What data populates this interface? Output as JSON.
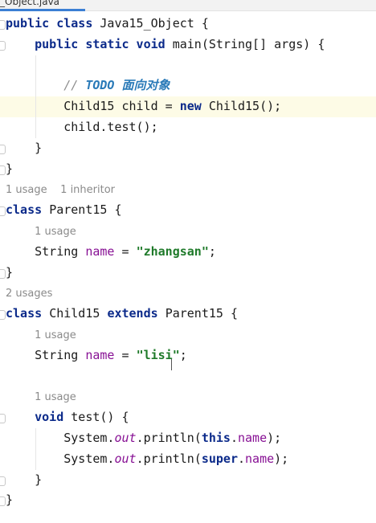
{
  "tab": {
    "label": "_Object.java"
  },
  "lines": [
    {
      "hl": false,
      "tokens": [
        [
          "kw",
          "public class "
        ],
        [
          "",
          "Java15_Object {"
        ]
      ]
    },
    {
      "hl": false,
      "tokens": [
        [
          "",
          "    "
        ],
        [
          "kw",
          "public static void "
        ],
        [
          "",
          "main(String[] args) {"
        ]
      ]
    },
    {
      "hl": false,
      "tokens": []
    },
    {
      "hl": false,
      "tokens": [
        [
          "",
          "        "
        ],
        [
          "cmt",
          "// "
        ],
        [
          "todo",
          "TODO 面向对象"
        ]
      ]
    },
    {
      "hl": true,
      "tokens": [
        [
          "",
          "        Child15 child = "
        ],
        [
          "kw",
          "new "
        ],
        [
          "",
          "Child15();"
        ]
      ]
    },
    {
      "hl": false,
      "tokens": [
        [
          "",
          "        child.test();"
        ]
      ]
    },
    {
      "hl": false,
      "tokens": [
        [
          "",
          "    }"
        ]
      ]
    },
    {
      "hl": false,
      "tokens": [
        [
          "",
          "}"
        ]
      ]
    },
    {
      "hl": false,
      "tokens": [
        [
          "hint",
          "1 usage    1 inheritor"
        ]
      ]
    },
    {
      "hl": false,
      "tokens": [
        [
          "kw",
          "class "
        ],
        [
          "",
          "Parent15 {"
        ]
      ]
    },
    {
      "hl": false,
      "tokens": [
        [
          "",
          "    "
        ],
        [
          "hint",
          "1 usage"
        ]
      ]
    },
    {
      "hl": false,
      "tokens": [
        [
          "",
          "    String "
        ],
        [
          "field",
          "name"
        ],
        [
          "",
          " = "
        ],
        [
          "str",
          "\"zhangsan\""
        ],
        [
          "",
          ";"
        ]
      ]
    },
    {
      "hl": false,
      "tokens": [
        [
          "",
          "}"
        ]
      ]
    },
    {
      "hl": false,
      "tokens": [
        [
          "hint",
          "2 usages"
        ]
      ]
    },
    {
      "hl": false,
      "tokens": [
        [
          "kw",
          "class "
        ],
        [
          "",
          "Child15 "
        ],
        [
          "kw",
          "extends "
        ],
        [
          "",
          "Parent15 {"
        ]
      ]
    },
    {
      "hl": false,
      "tokens": [
        [
          "",
          "    "
        ],
        [
          "hint",
          "1 usage"
        ]
      ]
    },
    {
      "hl": false,
      "tokens": [
        [
          "",
          "    String "
        ],
        [
          "field",
          "name"
        ],
        [
          "",
          " = "
        ],
        [
          "str",
          "\"lisi\""
        ],
        [
          "",
          ";"
        ]
      ]
    },
    {
      "hl": false,
      "tokens": []
    },
    {
      "hl": false,
      "tokens": [
        [
          "",
          "    "
        ],
        [
          "hint",
          "1 usage"
        ]
      ]
    },
    {
      "hl": false,
      "tokens": [
        [
          "",
          "    "
        ],
        [
          "kw",
          "void "
        ],
        [
          "",
          "test() {"
        ]
      ]
    },
    {
      "hl": false,
      "tokens": [
        [
          "",
          "        System."
        ],
        [
          "static",
          "out"
        ],
        [
          "",
          ".println("
        ],
        [
          "kw",
          "this"
        ],
        [
          "",
          "."
        ],
        [
          "field",
          "name"
        ],
        [
          "",
          ");"
        ]
      ]
    },
    {
      "hl": false,
      "tokens": [
        [
          "",
          "        System."
        ],
        [
          "static",
          "out"
        ],
        [
          "",
          ".println("
        ],
        [
          "kw",
          "super"
        ],
        [
          "",
          "."
        ],
        [
          "field",
          "name"
        ],
        [
          "",
          ");"
        ]
      ]
    },
    {
      "hl": false,
      "tokens": [
        [
          "",
          "    }"
        ]
      ]
    },
    {
      "hl": false,
      "tokens": [
        [
          "",
          "}"
        ]
      ]
    }
  ]
}
